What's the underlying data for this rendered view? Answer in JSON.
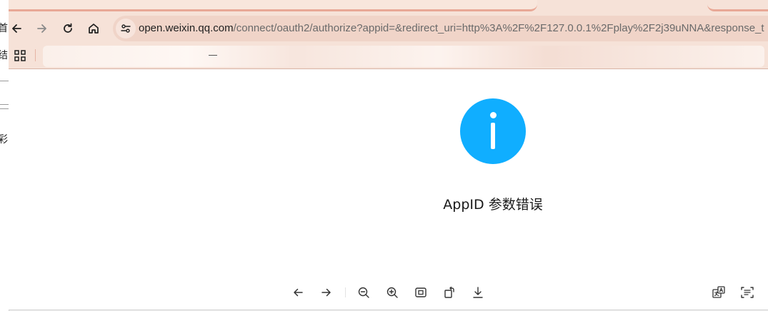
{
  "left_window": {
    "fragments": [
      "首",
      "结",
      "彩"
    ]
  },
  "toolbar": {
    "url_host": "open.weixin.qq.com",
    "url_path": "/connect/oauth2/authorize?appid=&redirect_uri=http%3A%2F%2F127.0.0.1%2Fplay%2F2j39uNNA&response_t"
  },
  "icons": {
    "back": "arrow-left-icon",
    "forward": "arrow-right-icon",
    "reload": "reload-icon",
    "home": "home-icon",
    "site_info": "tune-icon",
    "apps": "apps-grid-icon"
  },
  "page": {
    "message": "AppID 参数错误",
    "icon_color": "#10aeff"
  },
  "viewer_toolbar": {
    "items": [
      "arrow-left-icon",
      "arrow-right-icon",
      "zoom-out-icon",
      "zoom-in-icon",
      "fit-screen-icon",
      "rotate-icon",
      "download-icon",
      "translate-icon",
      "text-extract-icon"
    ]
  },
  "colors": {
    "chrome_bg": "#f6e2d8",
    "urlbar_bg": "#f0d4c8",
    "accent": "#10aeff"
  }
}
